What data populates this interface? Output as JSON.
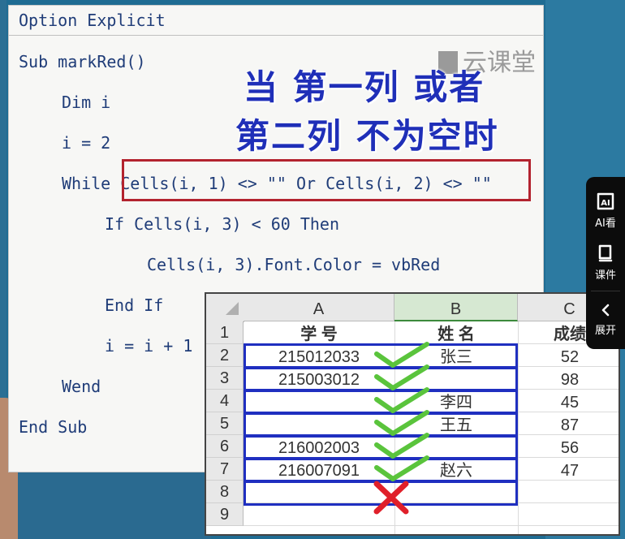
{
  "code": {
    "line1": "Option Explicit",
    "line2": "Sub markRed()",
    "line3": "Dim i",
    "line4": "i = 2",
    "line5": "While Cells(i, 1) <> \"\" Or Cells(i, 2) <> \"\"",
    "line6": "If Cells(i, 3) < 60 Then",
    "line7": "Cells(i, 3).Font.Color = vbRed",
    "line8": "End If",
    "line9": "i = i + 1",
    "line10": "Wend",
    "line11": "End Sub"
  },
  "overlay": {
    "title_line1": "当 第一列 或者",
    "title_line2": "第二列 不为空时"
  },
  "watermark": "云课堂",
  "sheet": {
    "col_headers": [
      "A",
      "B",
      "C"
    ],
    "row_numbers": [
      "1",
      "2",
      "3",
      "4",
      "5",
      "6",
      "7",
      "8",
      "9"
    ],
    "header_row": [
      "学  号",
      "姓  名",
      "成绩"
    ],
    "rows": [
      [
        "215012033",
        "张三",
        "52"
      ],
      [
        "215003012",
        "",
        "98"
      ],
      [
        "",
        "李四",
        "45"
      ],
      [
        "",
        "王五",
        "87"
      ],
      [
        "216002003",
        "",
        "56"
      ],
      [
        "216007091",
        "赵六",
        "47"
      ]
    ]
  },
  "side_panel": {
    "ai_label": "AI看",
    "courseware_label": "课件",
    "expand_label": "展开"
  },
  "colors": {
    "highlight_red": "#b3232f",
    "row_box_blue": "#1f2fc0",
    "check_green": "#5ac43c",
    "cross_red": "#e0202a"
  }
}
